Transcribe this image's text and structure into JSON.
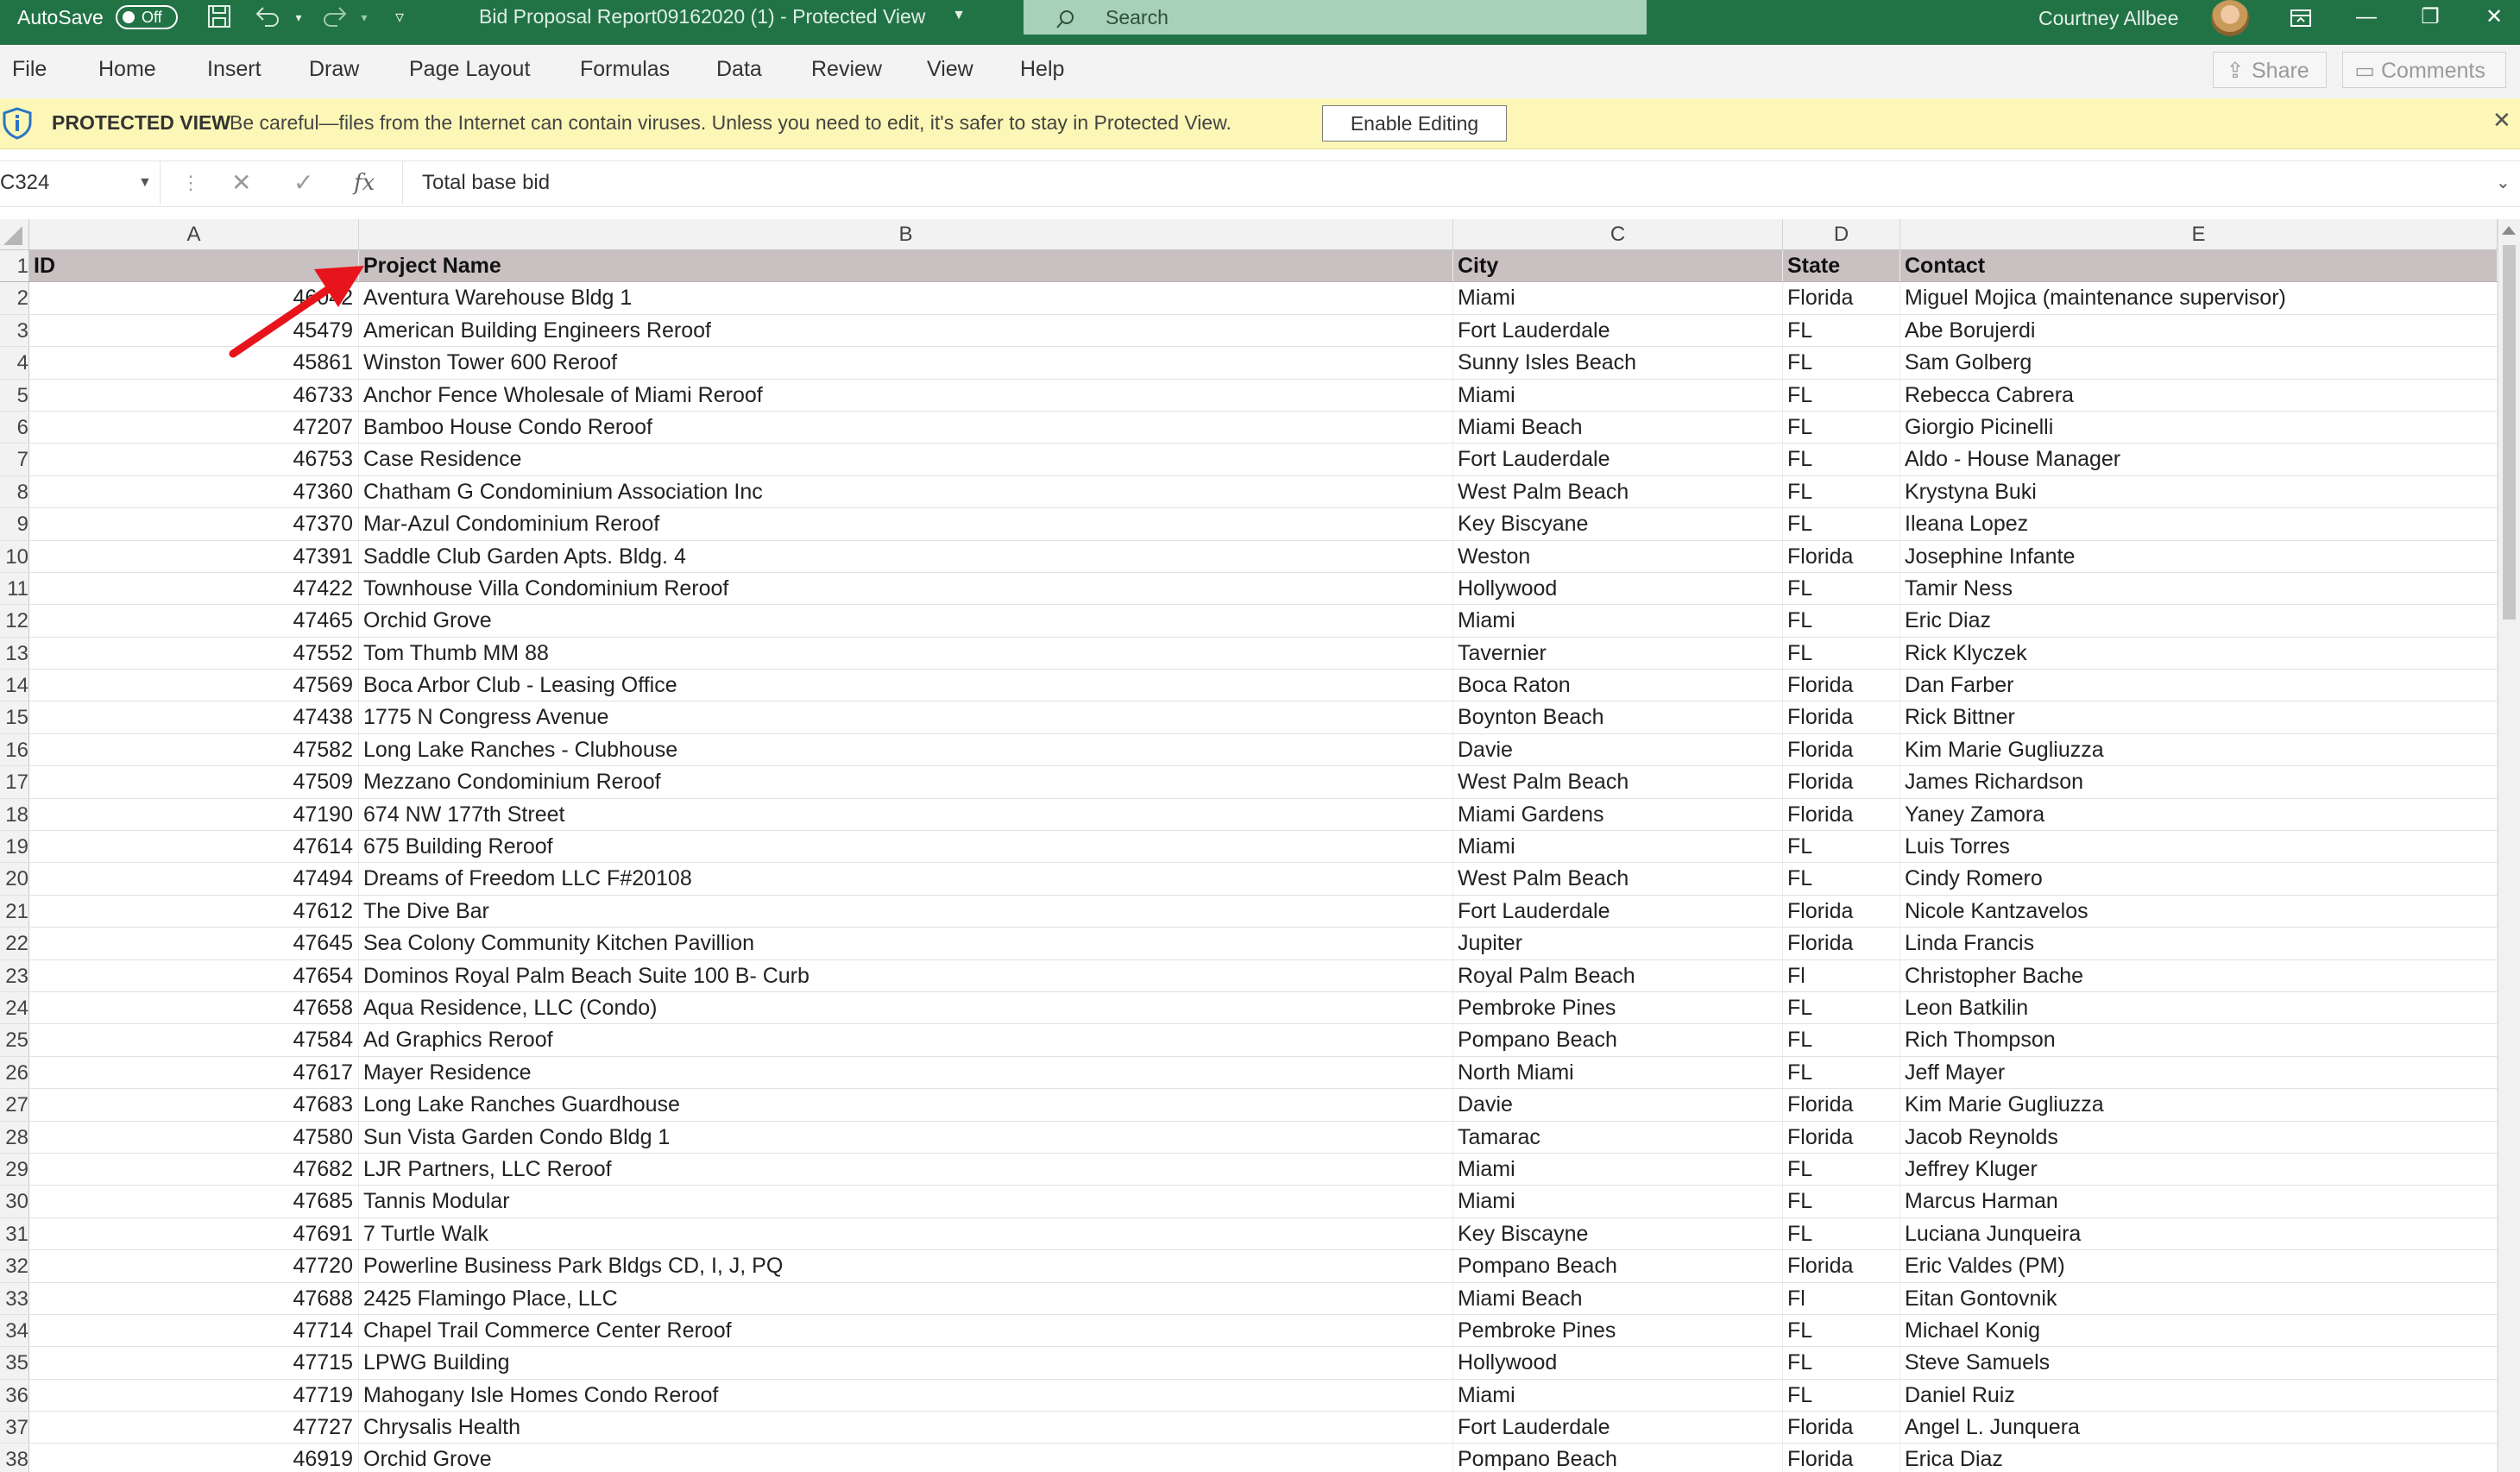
{
  "titlebar": {
    "autosave_label": "AutoSave",
    "autosave_state": "Off",
    "document_title": "Bid Proposal Report09162020 (1)  -  Protected View",
    "search_placeholder": "Search",
    "user_name": "Courtney  Allbee"
  },
  "menu": {
    "items": [
      "File",
      "Home",
      "Insert",
      "Draw",
      "Page Layout",
      "Formulas",
      "Data",
      "Review",
      "View",
      "Help"
    ],
    "share_label": "Share",
    "comments_label": "Comments"
  },
  "protected_view": {
    "title": "PROTECTED VIEW",
    "message": "Be careful—files from the Internet can contain viruses. Unless you need to edit, it's safer to stay in Protected View.",
    "enable_label": "Enable Editing"
  },
  "formula_bar": {
    "name_box": "C324",
    "fx_symbol": "fx",
    "formula": "Total base bid"
  },
  "grid": {
    "columns": [
      "A",
      "B",
      "C",
      "D",
      "E"
    ],
    "header_row": {
      "n": "1",
      "id": "ID",
      "project": "Project Name",
      "city": "City",
      "state": "State",
      "contact": "Contact"
    },
    "rows": [
      {
        "n": "2",
        "id": "46042",
        "project": "Aventura Warehouse Bldg 1",
        "city": "Miami",
        "state": "Florida",
        "contact": "Miguel Mojica (maintenance supervisor)"
      },
      {
        "n": "3",
        "id": "45479",
        "project": "American Building Engineers Reroof",
        "city": "Fort Lauderdale",
        "state": "FL",
        "contact": "Abe Borujerdi"
      },
      {
        "n": "4",
        "id": "45861",
        "project": "Winston Tower 600 Reroof",
        "city": "Sunny Isles Beach",
        "state": "FL",
        "contact": "Sam Golberg"
      },
      {
        "n": "5",
        "id": "46733",
        "project": "Anchor Fence Wholesale of Miami Reroof",
        "city": "Miami",
        "state": "FL",
        "contact": "Rebecca Cabrera"
      },
      {
        "n": "6",
        "id": "47207",
        "project": "Bamboo House Condo Reroof",
        "city": "Miami Beach",
        "state": "FL",
        "contact": "Giorgio Picinelli"
      },
      {
        "n": "7",
        "id": "46753",
        "project": "Case Residence",
        "city": "Fort Lauderdale",
        "state": "FL",
        "contact": "Aldo - House Manager"
      },
      {
        "n": "8",
        "id": "47360",
        "project": "Chatham G Condominium Association Inc",
        "city": "West Palm Beach",
        "state": "FL",
        "contact": "Krystyna Buki"
      },
      {
        "n": "9",
        "id": "47370",
        "project": "Mar-Azul Condominium Reroof",
        "city": "Key Biscyane",
        "state": "FL",
        "contact": "Ileana Lopez"
      },
      {
        "n": "10",
        "id": "47391",
        "project": "Saddle Club Garden Apts. Bldg. 4",
        "city": "Weston",
        "state": "Florida",
        "contact": "Josephine Infante"
      },
      {
        "n": "11",
        "id": "47422",
        "project": "Townhouse Villa Condominium Reroof",
        "city": "Hollywood",
        "state": "FL",
        "contact": "Tamir Ness"
      },
      {
        "n": "12",
        "id": "47465",
        "project": "Orchid Grove",
        "city": "Miami",
        "state": "FL",
        "contact": "Eric Diaz"
      },
      {
        "n": "13",
        "id": "47552",
        "project": "Tom Thumb MM 88",
        "city": "Tavernier",
        "state": "FL",
        "contact": "Rick Klyczek"
      },
      {
        "n": "14",
        "id": "47569",
        "project": "Boca Arbor Club - Leasing Office",
        "city": "Boca Raton",
        "state": "Florida",
        "contact": "Dan Farber"
      },
      {
        "n": "15",
        "id": "47438",
        "project": "1775 N Congress Avenue",
        "city": "Boynton Beach",
        "state": "Florida",
        "contact": "Rick Bittner"
      },
      {
        "n": "16",
        "id": "47582",
        "project": "Long Lake Ranches - Clubhouse",
        "city": "Davie",
        "state": "Florida",
        "contact": "Kim Marie Gugliuzza"
      },
      {
        "n": "17",
        "id": "47509",
        "project": "Mezzano Condominium Reroof",
        "city": "West Palm Beach",
        "state": "Florida",
        "contact": "James Richardson"
      },
      {
        "n": "18",
        "id": "47190",
        "project": "674 NW 177th Street",
        "city": "Miami Gardens",
        "state": "Florida",
        "contact": "Yaney Zamora"
      },
      {
        "n": "19",
        "id": "47614",
        "project": "675 Building Reroof",
        "city": "Miami",
        "state": "FL",
        "contact": "Luis Torres"
      },
      {
        "n": "20",
        "id": "47494",
        "project": "Dreams of Freedom LLC F#20108",
        "city": "West Palm Beach",
        "state": "FL",
        "contact": "Cindy Romero"
      },
      {
        "n": "21",
        "id": "47612",
        "project": "The Dive Bar",
        "city": "Fort Lauderdale",
        "state": "Florida",
        "contact": "Nicole Kantzavelos"
      },
      {
        "n": "22",
        "id": "47645",
        "project": "Sea Colony Community Kitchen Pavillion",
        "city": "Jupiter",
        "state": "Florida",
        "contact": "Linda Francis"
      },
      {
        "n": "23",
        "id": "47654",
        "project": "Dominos Royal Palm Beach Suite 100 B- Curb",
        "city": "Royal Palm Beach",
        "state": "Fl",
        "contact": "Christopher Bache"
      },
      {
        "n": "24",
        "id": "47658",
        "project": "Aqua Residence, LLC (Condo)",
        "city": "Pembroke Pines",
        "state": "FL",
        "contact": "Leon Batkilin"
      },
      {
        "n": "25",
        "id": "47584",
        "project": "Ad Graphics Reroof",
        "city": "Pompano Beach",
        "state": "FL",
        "contact": "Rich Thompson"
      },
      {
        "n": "26",
        "id": "47617",
        "project": "Mayer Residence",
        "city": "North Miami",
        "state": "FL",
        "contact": "Jeff Mayer"
      },
      {
        "n": "27",
        "id": "47683",
        "project": "Long Lake Ranches Guardhouse",
        "city": "Davie",
        "state": "Florida",
        "contact": "Kim Marie Gugliuzza"
      },
      {
        "n": "28",
        "id": "47580",
        "project": "Sun Vista Garden Condo Bldg 1",
        "city": "Tamarac",
        "state": "Florida",
        "contact": "Jacob Reynolds"
      },
      {
        "n": "29",
        "id": "47682",
        "project": "LJR Partners, LLC Reroof",
        "city": "Miami",
        "state": "FL",
        "contact": "Jeffrey Kluger"
      },
      {
        "n": "30",
        "id": "47685",
        "project": "Tannis Modular",
        "city": "Miami",
        "state": "FL",
        "contact": "Marcus Harman"
      },
      {
        "n": "31",
        "id": "47691",
        "project": "7 Turtle Walk",
        "city": "Key Biscayne",
        "state": "FL",
        "contact": "Luciana Junqueira"
      },
      {
        "n": "32",
        "id": "47720",
        "project": "Powerline Business Park Bldgs CD, I, J, PQ",
        "city": "Pompano Beach",
        "state": "Florida",
        "contact": "Eric Valdes (PM)"
      },
      {
        "n": "33",
        "id": "47688",
        "project": "2425 Flamingo Place, LLC",
        "city": "Miami Beach",
        "state": "Fl",
        "contact": "Eitan Gontovnik"
      },
      {
        "n": "34",
        "id": "47714",
        "project": "Chapel Trail Commerce Center Reroof",
        "city": "Pembroke Pines",
        "state": "FL",
        "contact": "Michael Konig"
      },
      {
        "n": "35",
        "id": "47715",
        "project": "LPWG Building",
        "city": "Hollywood",
        "state": "FL",
        "contact": "Steve Samuels"
      },
      {
        "n": "36",
        "id": "47719",
        "project": "Mahogany Isle Homes Condo Reroof",
        "city": "Miami",
        "state": "FL",
        "contact": "Daniel Ruiz"
      },
      {
        "n": "37",
        "id": "47727",
        "project": "Chrysalis Health",
        "city": "Fort Lauderdale",
        "state": "Florida",
        "contact": "Angel L. Junquera"
      },
      {
        "n": "38",
        "id": "46919",
        "project": "Orchid Grove",
        "city": "Pompano Beach",
        "state": "Florida",
        "contact": "Erica Diaz"
      }
    ]
  },
  "colors": {
    "excel_green": "#217346",
    "search_box": "#a7d1b9",
    "protected_bar": "#fcf7b6",
    "header_row_fill": "#c9c1c1",
    "annotation_arrow": "#e8141b"
  },
  "icons": {
    "save": "save-icon",
    "undo": "undo-icon",
    "redo": "redo-icon",
    "customize": "quick-access-dropdown-icon",
    "search": "search-icon",
    "shield": "shield-info-icon",
    "annotation": "red-arrow-icon"
  }
}
